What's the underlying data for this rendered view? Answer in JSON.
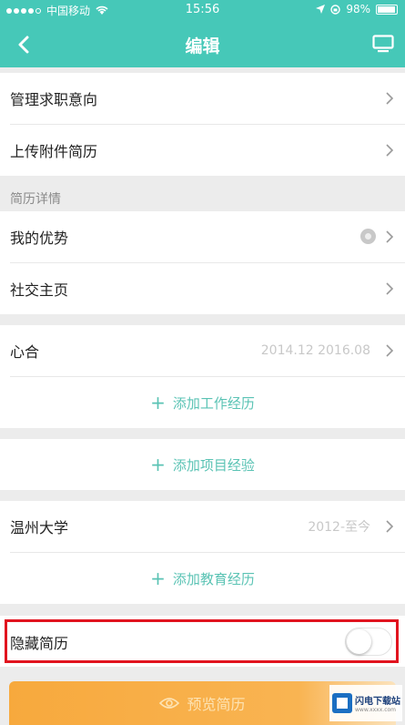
{
  "status_bar": {
    "carrier": "中国移动",
    "time": "15:56",
    "battery": "98%"
  },
  "nav": {
    "title": "编辑",
    "back_icon": "chevron-left-icon",
    "preview_icon": "monitor-icon"
  },
  "top_group": [
    {
      "label": "管理求职意向"
    },
    {
      "label": "上传附件简历"
    }
  ],
  "resume_section": {
    "header": "简历详情",
    "items": [
      {
        "label": "我的优势"
      },
      {
        "label": "社交主页"
      }
    ]
  },
  "work": {
    "company": "心合",
    "period": "2014.12 2016.08",
    "add_label": "添加工作经历"
  },
  "project": {
    "add_label": "添加项目经验"
  },
  "education": {
    "school": "温州大学",
    "period": "2012-至今",
    "add_label": "添加教育经历"
  },
  "hide_resume": {
    "label": "隐藏简历",
    "enabled": false
  },
  "preview_button": {
    "label": "预览简历"
  },
  "watermark": {
    "name": "闪电下载站",
    "url": "www.xxxx.com"
  },
  "colors": {
    "teal": "#46c8b8",
    "accent_text": "#5ac3b4",
    "highlight_border": "#e1141f",
    "button_orange": "#f7a93d"
  }
}
